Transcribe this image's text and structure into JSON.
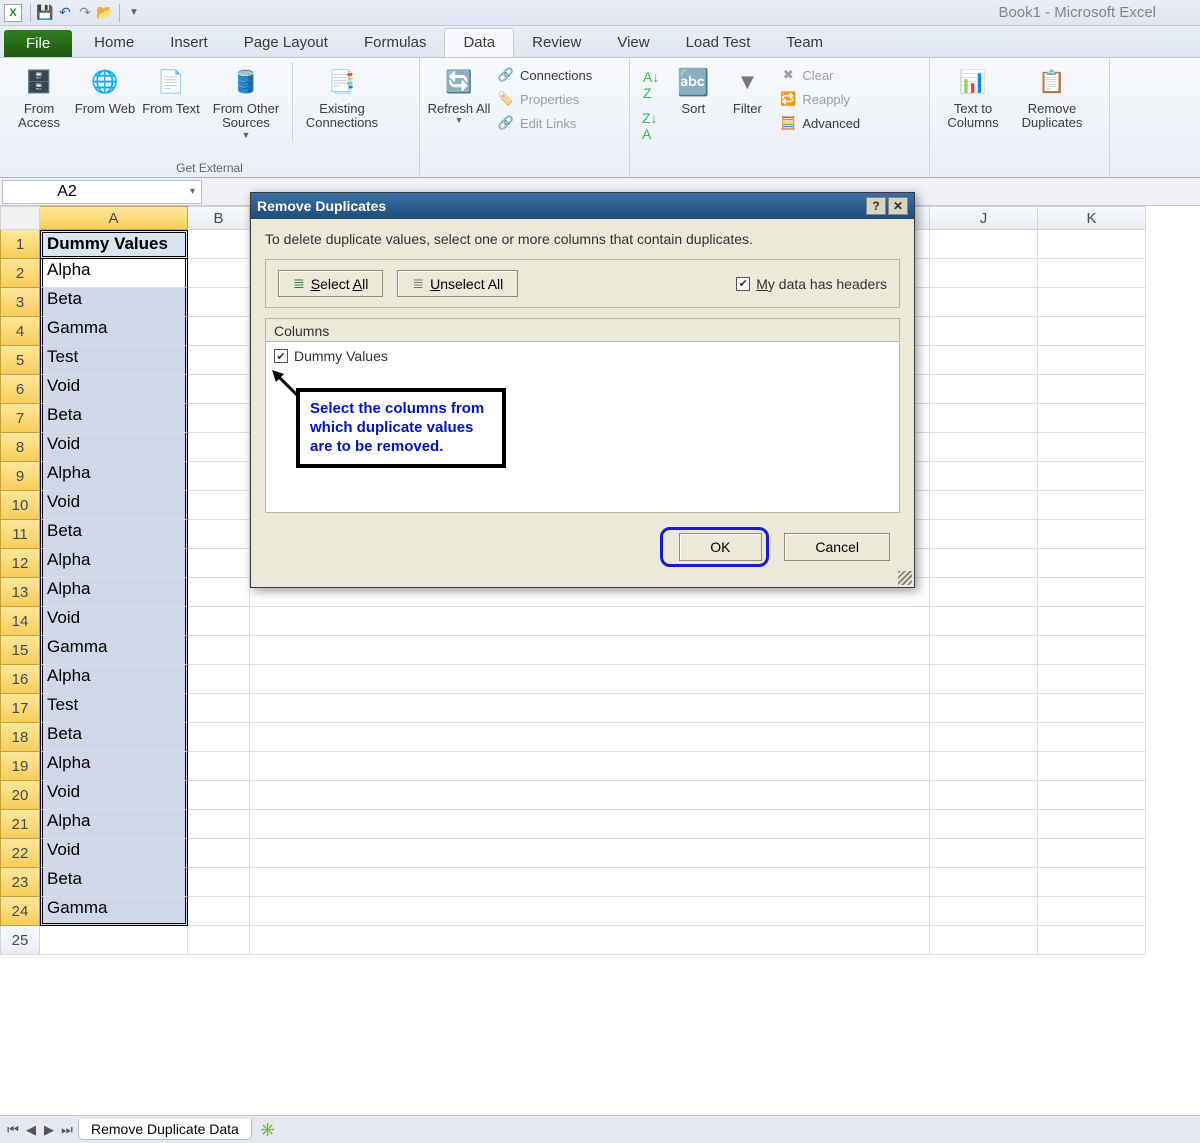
{
  "app_title": "Book1 - Microsoft Excel",
  "tabs": {
    "file": "File",
    "home": "Home",
    "insert": "Insert",
    "page_layout": "Page Layout",
    "formulas": "Formulas",
    "data": "Data",
    "review": "Review",
    "view": "View",
    "load_test": "Load Test",
    "team": "Team"
  },
  "ribbon": {
    "get_external_data": {
      "from_access": "From Access",
      "from_web": "From Web",
      "from_text": "From Text",
      "from_other": "From Other Sources",
      "existing_conn": "Existing Connections",
      "group_label": "Get External"
    },
    "connections": {
      "refresh_all": "Refresh All",
      "connections": "Connections",
      "properties": "Properties",
      "edit_links": "Edit Links"
    },
    "sort_filter": {
      "sort": "Sort",
      "filter": "Filter",
      "clear": "Clear",
      "reapply": "Reapply",
      "advanced": "Advanced"
    },
    "data_tools": {
      "text_to_columns": "Text to Columns",
      "remove_duplicates": "Remove Duplicates"
    }
  },
  "name_box": "A2",
  "columns": [
    "A",
    "B",
    "J",
    "K"
  ],
  "row_headers": [
    "1",
    "2",
    "3",
    "4",
    "5",
    "6",
    "7",
    "8",
    "9",
    "10",
    "11",
    "12",
    "13",
    "14",
    "15",
    "16",
    "17",
    "18",
    "19",
    "20",
    "21",
    "22",
    "23",
    "24",
    "25"
  ],
  "header_cell": "Dummy Values",
  "data_values": [
    "Alpha",
    "Beta",
    "Gamma",
    "Test",
    "Void",
    "Beta",
    "Void",
    "Alpha",
    "Void",
    "Beta",
    "Alpha",
    "Alpha",
    "Void",
    "Gamma",
    "Alpha",
    "Test",
    "Beta",
    "Alpha",
    "Void",
    "Alpha",
    "Void",
    "Beta",
    "Gamma"
  ],
  "sheet_tab": "Remove Duplicate Data",
  "dialog": {
    "title": "Remove Duplicates",
    "instructions": "To delete duplicate values, select one or more columns that contain duplicates.",
    "select_all": "Select All",
    "unselect_all": "Unselect All",
    "headers_chk": "My data has headers",
    "columns_label": "Columns",
    "col_item": "Dummy Values",
    "ok": "OK",
    "cancel": "Cancel"
  },
  "callout_text": "Select the columns from which duplicate values are to be removed."
}
